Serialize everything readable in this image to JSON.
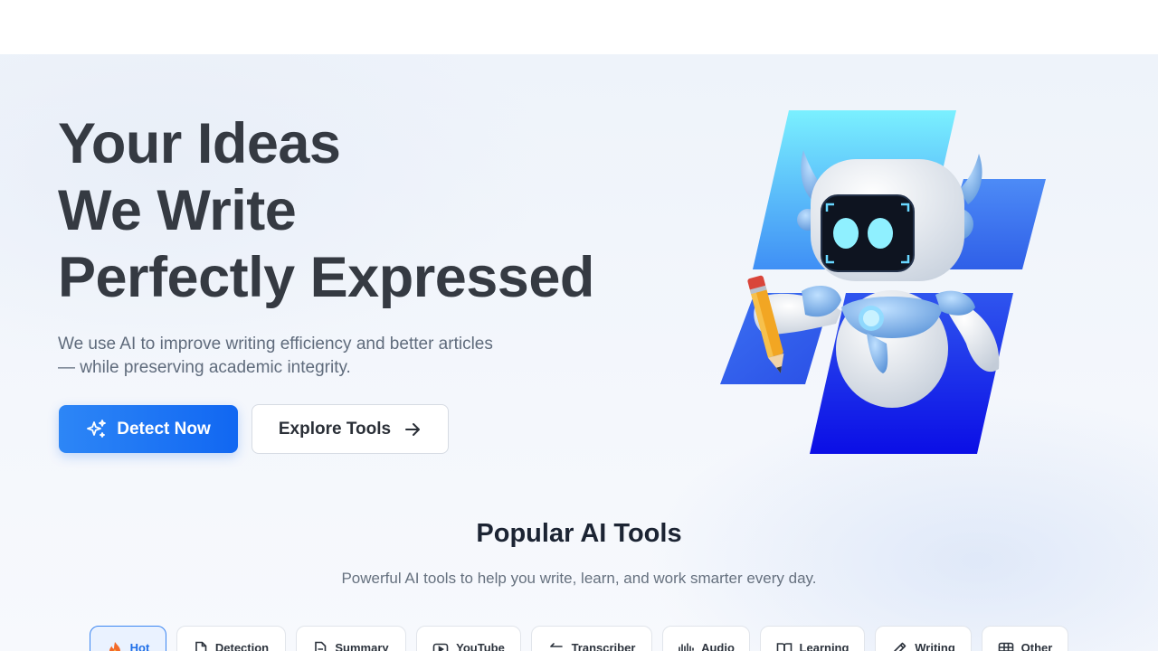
{
  "hero": {
    "headline": [
      "Your Ideas",
      "We Write",
      "Perfectly Expressed"
    ],
    "subtext_line1": "We use AI to improve writing efficiency and better articles",
    "subtext_line2": "— while preserving academic integrity.",
    "primary_button": {
      "label": "Detect Now",
      "icon": "sparkle-icon"
    },
    "secondary_button": {
      "label": "Explore Tools",
      "icon": "arrow-right-icon"
    }
  },
  "tools_section": {
    "title": "Popular AI Tools",
    "subtitle": "Powerful AI tools to help you write, learn, and work smarter every day.",
    "tabs": [
      {
        "label": "Hot",
        "icon": "fire-icon",
        "active": true
      },
      {
        "label": "Detection",
        "icon": "document-icon",
        "active": false
      },
      {
        "label": "Summary",
        "icon": "document-lines-icon",
        "active": false
      },
      {
        "label": "YouTube",
        "icon": "video-play-icon",
        "active": false
      },
      {
        "label": "Transcriber",
        "icon": "arrows-swap-icon",
        "active": false
      },
      {
        "label": "Audio",
        "icon": "audio-bars-icon",
        "active": false
      },
      {
        "label": "Learning",
        "icon": "book-icon",
        "active": false
      },
      {
        "label": "Writing",
        "icon": "pencil-icon",
        "active": false
      },
      {
        "label": "Other",
        "icon": "grid-icon",
        "active": false
      }
    ]
  },
  "colors": {
    "primary": "#1167f2",
    "headline": "#353a42",
    "active_tab_bg": "#eaf2ff",
    "active_tab_border": "#3c86f2"
  }
}
